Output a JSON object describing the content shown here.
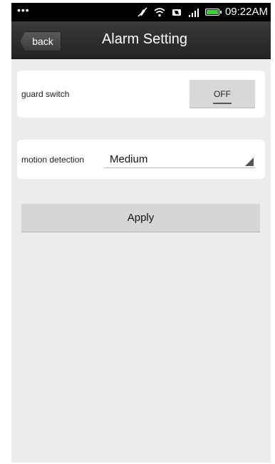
{
  "status_bar": {
    "dots": "•••",
    "time": "09:22AM",
    "icons": [
      "mute-icon",
      "wifi-icon",
      "camera-icon",
      "signal-icon",
      "battery-icon"
    ],
    "battery_color": "#3ad13a"
  },
  "header": {
    "back_label": "back",
    "title": "Alarm Setting"
  },
  "guard": {
    "label": "guard switch",
    "toggle_value": "OFF"
  },
  "motion": {
    "label": "motion detection",
    "selected": "Medium"
  },
  "apply_label": "Apply",
  "colors": {
    "background": "#ececec",
    "titlebar": "#2e2e2e",
    "button": "#d6d6d6"
  }
}
